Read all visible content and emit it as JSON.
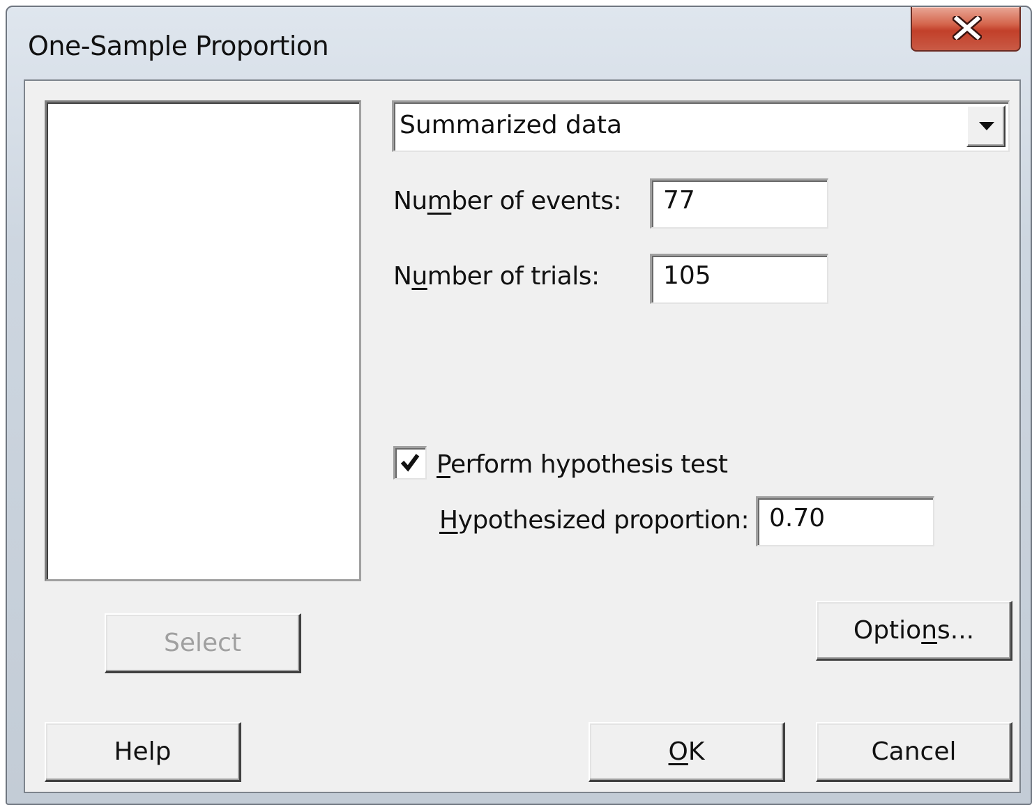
{
  "window": {
    "title": "One-Sample Proportion",
    "close_icon": "close-icon"
  },
  "left_panel": {
    "select_label": "Select"
  },
  "data_source": {
    "selected": "Summarized data",
    "dropdown_icon": "chevron-down-icon"
  },
  "fields": {
    "events": {
      "label_pre": "Nu",
      "label_key": "m",
      "label_post": "ber of events:",
      "value": "77"
    },
    "trials": {
      "label_pre": "N",
      "label_key": "u",
      "label_post": "mber of trials:",
      "value": "105"
    }
  },
  "hypothesis": {
    "checkbox_label_key": "P",
    "checkbox_label_rest": "erform hypothesis test",
    "checked": true,
    "proportion_label_key": "H",
    "proportion_label_rest": "ypothesized proportion:",
    "proportion_value": "0.70"
  },
  "buttons": {
    "options_pre": "Optio",
    "options_key": "n",
    "options_post": "s...",
    "help": "Help",
    "ok_key": "O",
    "ok_rest": "K",
    "cancel": "Cancel"
  }
}
